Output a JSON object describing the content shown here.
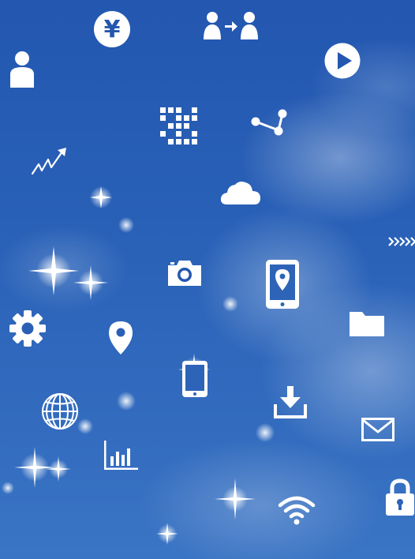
{
  "scene": {
    "description_colors": {
      "sky_top": "#2357b0",
      "sky_bottom": "#3a74c4",
      "icon": "#ffffff"
    },
    "icons": [
      "yen-icon",
      "person-transfer-icon",
      "person-icon",
      "play-icon",
      "qr-code-icon",
      "share-icon",
      "growth-chart-icon",
      "cloud-icon",
      "double-chevron-icon",
      "camera-icon",
      "tablet-location-icon",
      "gear-icon",
      "location-pin-icon",
      "folder-icon",
      "smartphone-icon",
      "globe-icon",
      "download-icon",
      "mail-icon",
      "bar-chart-icon",
      "lock-icon",
      "wifi-icon"
    ]
  }
}
